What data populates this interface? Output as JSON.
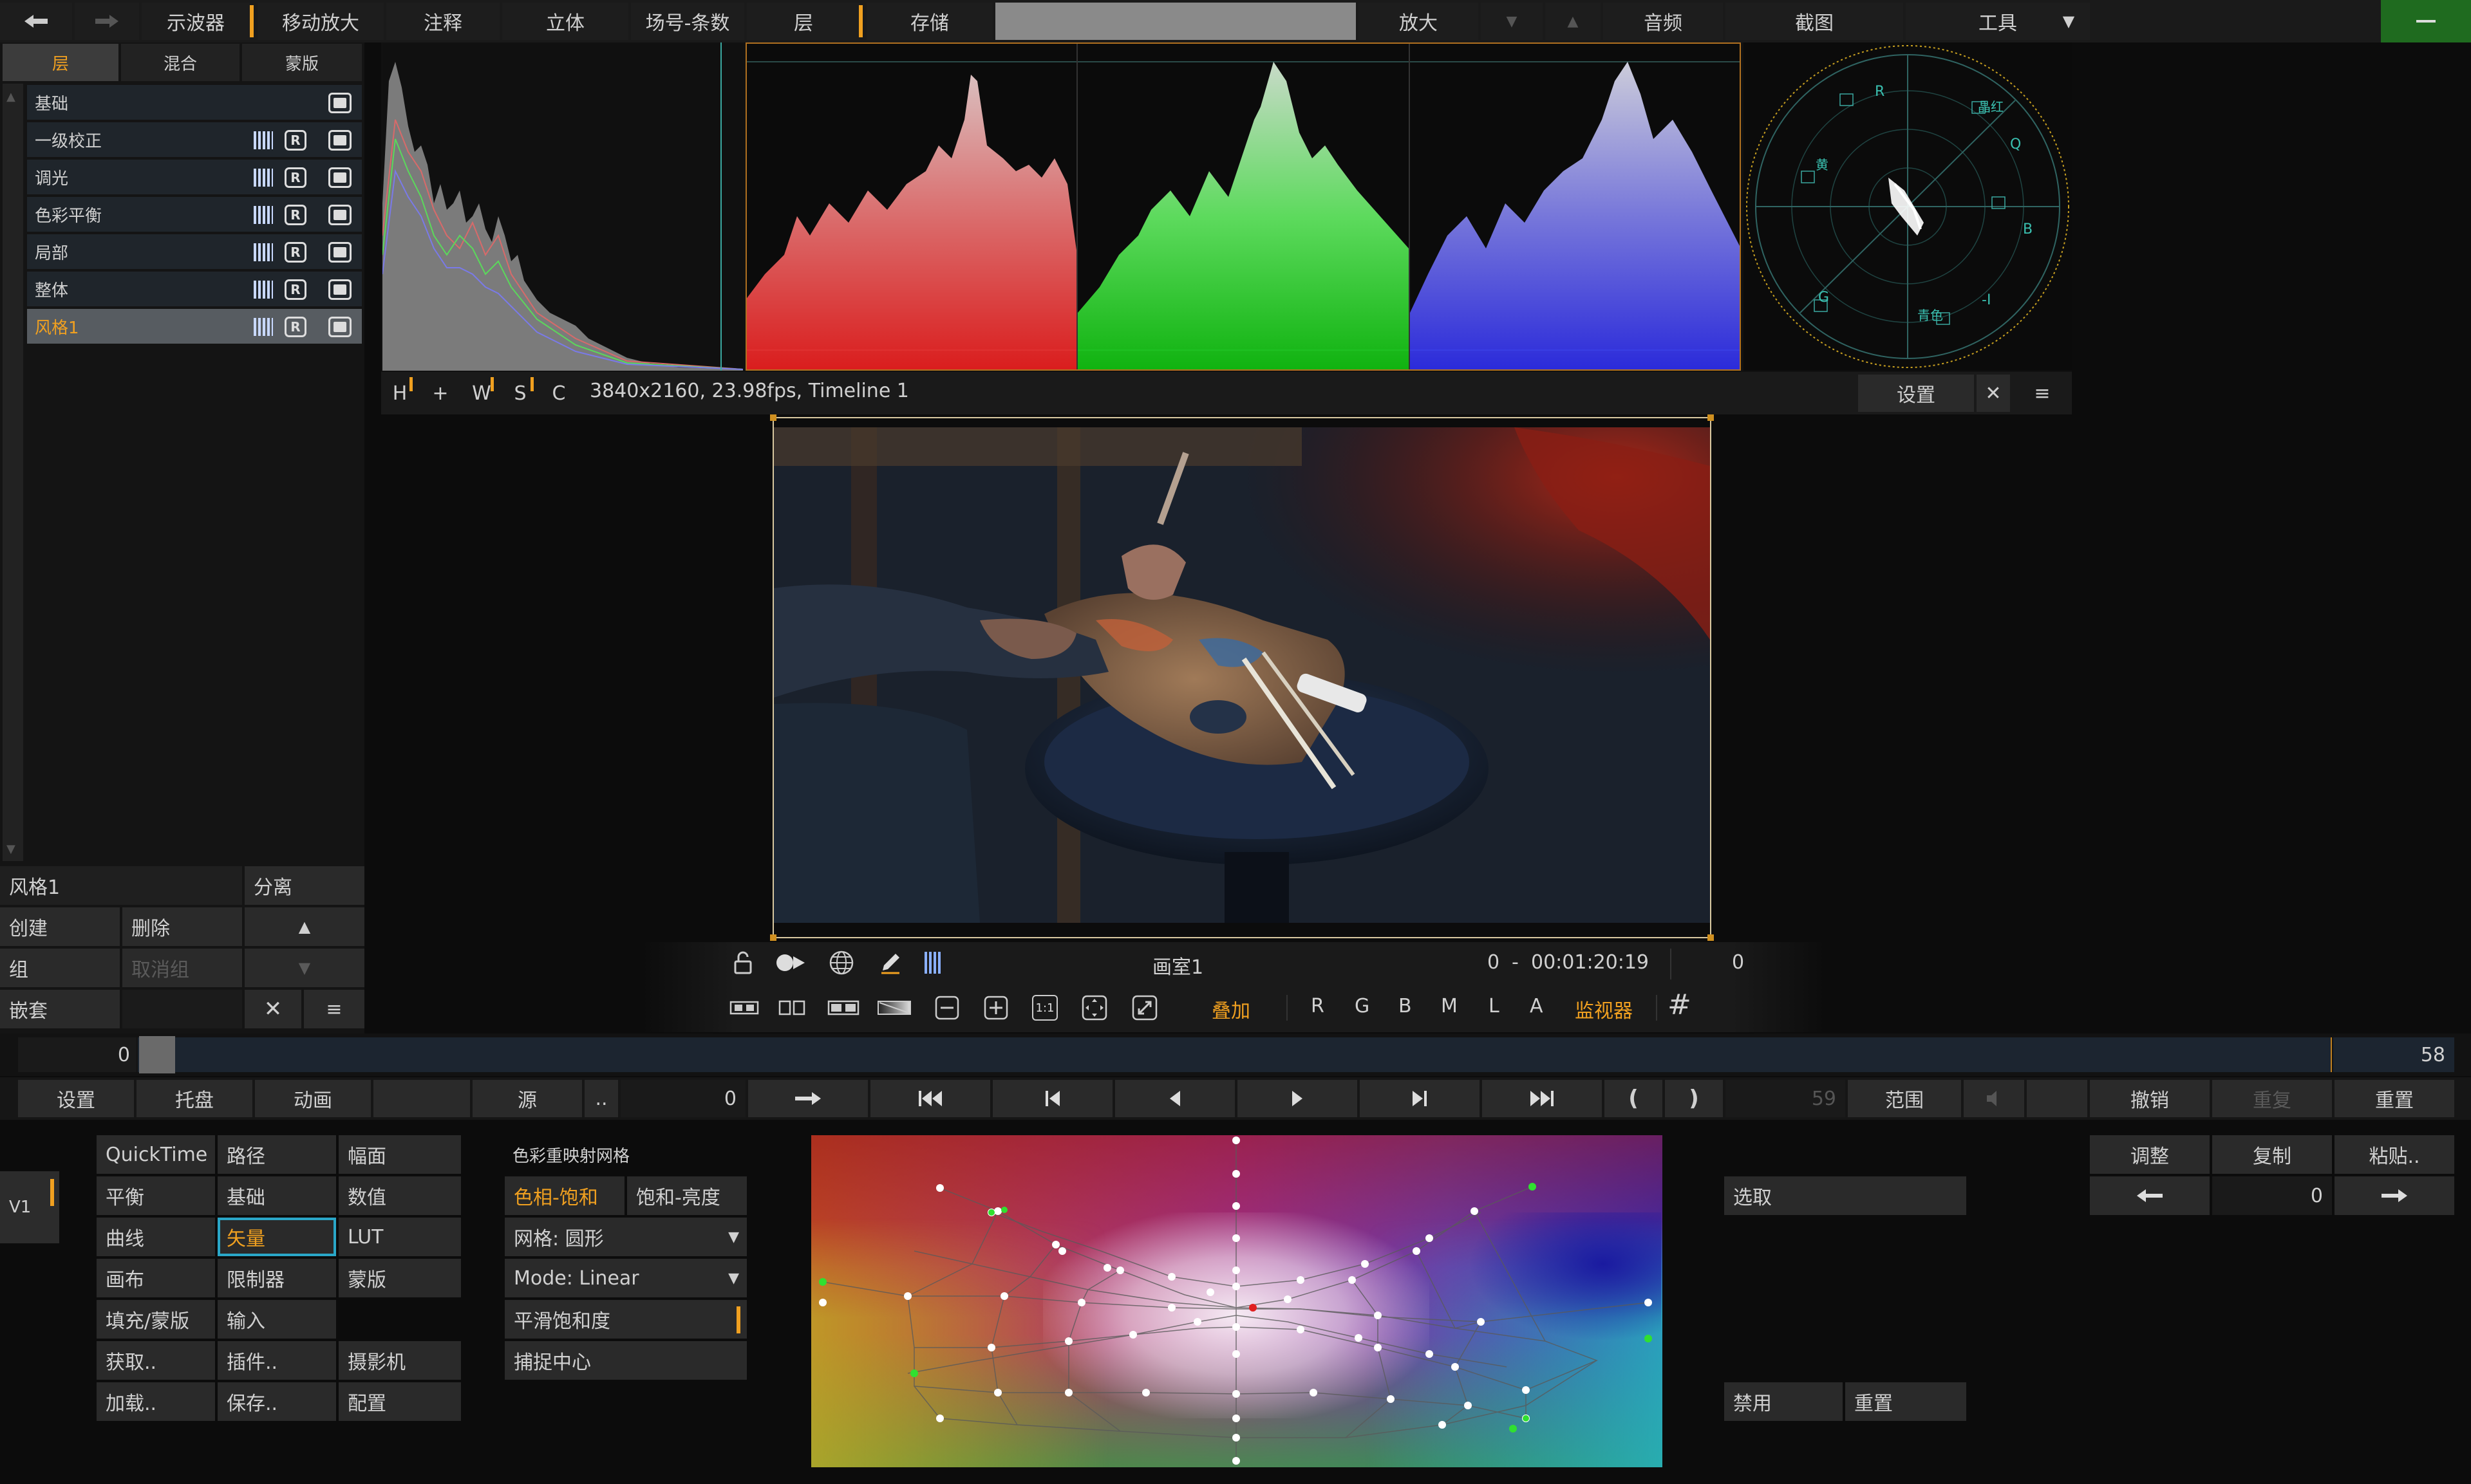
{
  "top_bar": {
    "items": [
      "示波器",
      "移动放大",
      "注释",
      "立体",
      "场号-条数",
      "层",
      "存储",
      "放大",
      "音频",
      "截图",
      "工具"
    ]
  },
  "left_panel": {
    "tabs": [
      "层",
      "混合",
      "蒙版"
    ],
    "layers": [
      "基础",
      "一级校正",
      "调光",
      "色彩平衡",
      "局部",
      "整体",
      "风格1"
    ],
    "selected_name": "风格1",
    "separate": "分离",
    "create": "创建",
    "delete": "删除",
    "group": "组",
    "ungroup": "取消组",
    "nest": "嵌套"
  },
  "scopes": {
    "info": "3840x2160, 23.98fps, Timeline 1",
    "footer_buttons": [
      "H",
      "+",
      "W",
      "S",
      "C"
    ],
    "settings": "设置",
    "vectorscope_labels": [
      "R",
      "晶红",
      "Q",
      "黄",
      "B",
      "G",
      "-I",
      "青色"
    ]
  },
  "viewer": {
    "gallery_label": "画室1",
    "range_start": "0",
    "range_sep": "-",
    "timecode": "00:01:20:19",
    "frame": "0",
    "zoom_11": "1:1",
    "overlay": "叠加",
    "channels": [
      "R",
      "G",
      "B",
      "M",
      "L",
      "A"
    ],
    "monitor": "监视器"
  },
  "timeline": {
    "start": "0",
    "end": "58"
  },
  "transport": {
    "settings": "设置",
    "tray": "托盘",
    "animation": "动画",
    "source": "源",
    "dots": "..",
    "frame": "0",
    "end_frame": "59",
    "range": "范围",
    "undo": "撤销",
    "redo": "重复",
    "reset": "重置"
  },
  "track": {
    "label": "V1"
  },
  "menu_grid": [
    [
      "QuickTime",
      "路径",
      "幅面"
    ],
    [
      "平衡",
      "基础",
      "数值"
    ],
    [
      "曲线",
      "矢量",
      "LUT"
    ],
    [
      "画布",
      "限制器",
      "蒙版"
    ],
    [
      "填充/蒙版",
      "输入",
      ""
    ],
    [
      "获取..",
      "插件..",
      "摄影机"
    ],
    [
      "加载..",
      "保存..",
      "配置"
    ]
  ],
  "mesh_panel": {
    "title": "色彩重映射网格",
    "tab_hue_sat": "色相-饱和",
    "tab_sat_lum": "饱和-亮度",
    "grid": "网格: 圆形",
    "mode": "Mode: Linear",
    "smooth": "平滑饱和度",
    "capture": "捕捉中心"
  },
  "right_side": {
    "select": "选取",
    "disable": "禁用",
    "reset": "重置",
    "adjust": "调整",
    "copy": "复制",
    "paste": "粘贴..",
    "value": "0"
  },
  "colors": {
    "accent": "#f0a020",
    "panel": "#2a2a2a",
    "selected_menu_border": "#2aa7c8"
  }
}
